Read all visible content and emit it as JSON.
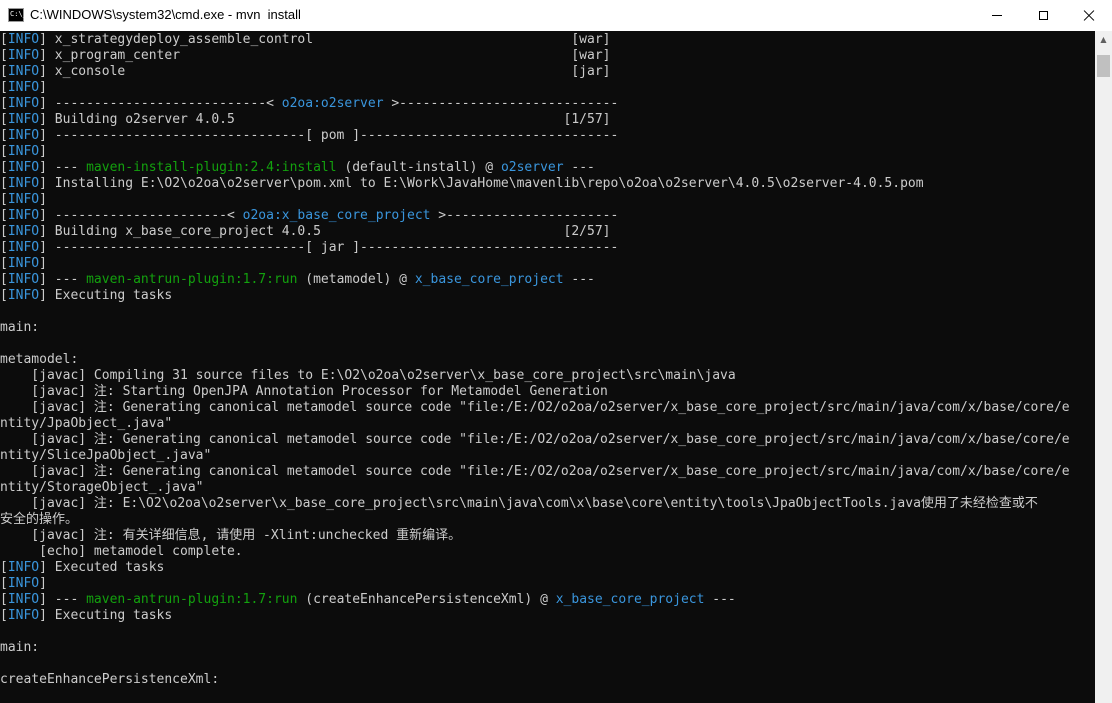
{
  "window": {
    "title": "C:\\WINDOWS\\system32\\cmd.exe - mvn  install",
    "icon_text": "C:\\_",
    "icons": {
      "app": "console-app-icon",
      "minimize": "minimize-icon",
      "maximize": "maximize-icon",
      "close": "close-icon",
      "scroll_up": "chevron-up-icon"
    }
  },
  "colors": {
    "info_tag": "#3a96dd",
    "plugin": "#13a10e",
    "artifact": "#3a96dd",
    "text": "#cccccc",
    "background": "#0c0c0c"
  },
  "console": {
    "lines": [
      [
        [
          "[",
          "c"
        ],
        [
          "INFO",
          "t"
        ],
        [
          "] x_strategydeploy_assemble_control                                 [war]",
          "c"
        ]
      ],
      [
        [
          "[",
          "c"
        ],
        [
          "INFO",
          "t"
        ],
        [
          "] x_program_center                                                  [war]",
          "c"
        ]
      ],
      [
        [
          "[",
          "c"
        ],
        [
          "INFO",
          "t"
        ],
        [
          "] x_console                                                         [jar]",
          "c"
        ]
      ],
      [
        [
          "[",
          "c"
        ],
        [
          "INFO",
          "t"
        ],
        [
          "]",
          "c"
        ]
      ],
      [
        [
          "[",
          "c"
        ],
        [
          "INFO",
          "t"
        ],
        [
          "] ---------------------------< ",
          "c"
        ],
        [
          "o2oa:o2server",
          "b"
        ],
        [
          " >----------------------------",
          "c"
        ]
      ],
      [
        [
          "[",
          "c"
        ],
        [
          "INFO",
          "t"
        ],
        [
          "] Building o2server 4.0.5                                          [1/57]",
          "c"
        ]
      ],
      [
        [
          "[",
          "c"
        ],
        [
          "INFO",
          "t"
        ],
        [
          "] --------------------------------[ pom ]---------------------------------",
          "c"
        ]
      ],
      [
        [
          "[",
          "c"
        ],
        [
          "INFO",
          "t"
        ],
        [
          "]",
          "c"
        ]
      ],
      [
        [
          "[",
          "c"
        ],
        [
          "INFO",
          "t"
        ],
        [
          "] --- ",
          "c"
        ],
        [
          "maven-install-plugin:2.4:install",
          "g"
        ],
        [
          " (default-install) @ ",
          "c"
        ],
        [
          "o2server",
          "b"
        ],
        [
          " ---",
          "c"
        ]
      ],
      [
        [
          "[",
          "c"
        ],
        [
          "INFO",
          "t"
        ],
        [
          "] Installing E:\\O2\\o2oa\\o2server\\pom.xml to E:\\Work\\JavaHome\\mavenlib\\repo\\o2oa\\o2server\\4.0.5\\o2server-4.0.5.pom",
          "c"
        ]
      ],
      [
        [
          "[",
          "c"
        ],
        [
          "INFO",
          "t"
        ],
        [
          "]",
          "c"
        ]
      ],
      [
        [
          "[",
          "c"
        ],
        [
          "INFO",
          "t"
        ],
        [
          "] ----------------------< ",
          "c"
        ],
        [
          "o2oa:x_base_core_project",
          "b"
        ],
        [
          " >----------------------",
          "c"
        ]
      ],
      [
        [
          "[",
          "c"
        ],
        [
          "INFO",
          "t"
        ],
        [
          "] Building x_base_core_project 4.0.5                               [2/57]",
          "c"
        ]
      ],
      [
        [
          "[",
          "c"
        ],
        [
          "INFO",
          "t"
        ],
        [
          "] --------------------------------[ jar ]---------------------------------",
          "c"
        ]
      ],
      [
        [
          "[",
          "c"
        ],
        [
          "INFO",
          "t"
        ],
        [
          "]",
          "c"
        ]
      ],
      [
        [
          "[",
          "c"
        ],
        [
          "INFO",
          "t"
        ],
        [
          "] --- ",
          "c"
        ],
        [
          "maven-antrun-plugin:1.7:run",
          "g"
        ],
        [
          " (metamodel) @ ",
          "c"
        ],
        [
          "x_base_core_project",
          "b"
        ],
        [
          " ---",
          "c"
        ]
      ],
      [
        [
          "[",
          "c"
        ],
        [
          "INFO",
          "t"
        ],
        [
          "] Executing tasks",
          "c"
        ]
      ],
      [],
      [
        [
          "main:",
          "c"
        ]
      ],
      [],
      [
        [
          "metamodel:",
          "c"
        ]
      ],
      [
        [
          "    [javac] Compiling 31 source files to E:\\O2\\o2oa\\o2server\\x_base_core_project\\src\\main\\java",
          "c"
        ]
      ],
      [
        [
          "    [javac] 注: Starting OpenJPA Annotation Processor for Metamodel Generation",
          "c"
        ]
      ],
      [
        [
          "    [javac] 注: Generating canonical metamodel source code \"file:/E:/O2/o2oa/o2server/x_base_core_project/src/main/java/com/x/base/core/e",
          "c"
        ]
      ],
      [
        [
          "ntity/JpaObject_.java\"",
          "c"
        ]
      ],
      [
        [
          "    [javac] 注: Generating canonical metamodel source code \"file:/E:/O2/o2oa/o2server/x_base_core_project/src/main/java/com/x/base/core/e",
          "c"
        ]
      ],
      [
        [
          "ntity/SliceJpaObject_.java\"",
          "c"
        ]
      ],
      [
        [
          "    [javac] 注: Generating canonical metamodel source code \"file:/E:/O2/o2oa/o2server/x_base_core_project/src/main/java/com/x/base/core/e",
          "c"
        ]
      ],
      [
        [
          "ntity/StorageObject_.java\"",
          "c"
        ]
      ],
      [
        [
          "    [javac] 注: E:\\O2\\o2oa\\o2server\\x_base_core_project\\src\\main\\java\\com\\x\\base\\core\\entity\\tools\\JpaObjectTools.java使用了未经检查或不",
          "c"
        ]
      ],
      [
        [
          "安全的操作。",
          "c"
        ]
      ],
      [
        [
          "    [javac] 注: 有关详细信息, 请使用 -Xlint:unchecked 重新编译。",
          "c"
        ]
      ],
      [
        [
          "     [echo] metamodel complete.",
          "c"
        ]
      ],
      [
        [
          "[",
          "c"
        ],
        [
          "INFO",
          "t"
        ],
        [
          "] Executed tasks",
          "c"
        ]
      ],
      [
        [
          "[",
          "c"
        ],
        [
          "INFO",
          "t"
        ],
        [
          "]",
          "c"
        ]
      ],
      [
        [
          "[",
          "c"
        ],
        [
          "INFO",
          "t"
        ],
        [
          "] --- ",
          "c"
        ],
        [
          "maven-antrun-plugin:1.7:run",
          "g"
        ],
        [
          " (createEnhancePersistenceXml) @ ",
          "c"
        ],
        [
          "x_base_core_project",
          "b"
        ],
        [
          " ---",
          "c"
        ]
      ],
      [
        [
          "[",
          "c"
        ],
        [
          "INFO",
          "t"
        ],
        [
          "] Executing tasks",
          "c"
        ]
      ],
      [],
      [
        [
          "main:",
          "c"
        ]
      ],
      [],
      [
        [
          "createEnhancePersistenceXml:",
          "c"
        ]
      ]
    ]
  }
}
